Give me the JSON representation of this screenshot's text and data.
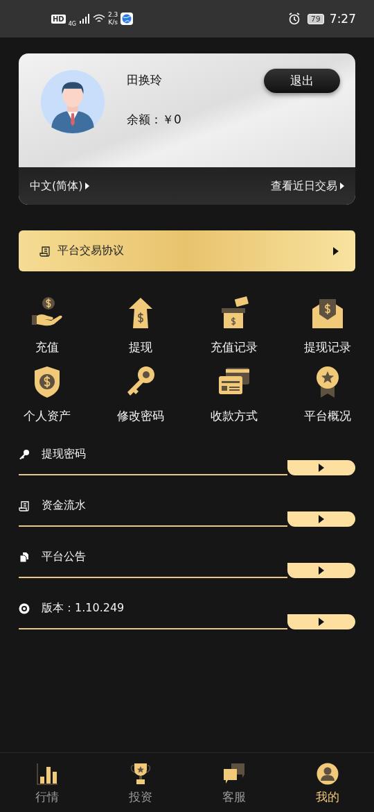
{
  "status_bar": {
    "hd": "HD",
    "network": "4G",
    "speed_value": "2.3",
    "speed_unit": "K/s",
    "battery": "79",
    "time": "7:27"
  },
  "profile": {
    "name": "田换玲",
    "balance": "余额：￥0",
    "logout": "退出",
    "language": "中文(简体)",
    "recent": "查看近日交易"
  },
  "agreement": {
    "label": "平台交易协议"
  },
  "shortcuts": [
    {
      "kind": "deposit",
      "label": "充值"
    },
    {
      "kind": "withdraw",
      "label": "提现"
    },
    {
      "kind": "deposit_log",
      "label": "充值记录"
    },
    {
      "kind": "withdraw_log",
      "label": "提现记录"
    },
    {
      "kind": "assets",
      "label": "个人资产"
    },
    {
      "kind": "password",
      "label": "修改密码"
    },
    {
      "kind": "payment",
      "label": "收款方式"
    },
    {
      "kind": "overview",
      "label": "平台概况"
    }
  ],
  "menu": [
    {
      "kind": "key",
      "label": "提现密码"
    },
    {
      "kind": "receipt",
      "label": "资金流水"
    },
    {
      "kind": "notice",
      "label": "平台公告"
    },
    {
      "kind": "disc",
      "label": "版本：1.10.249"
    }
  ],
  "tabs": [
    {
      "kind": "chart",
      "label": "行情",
      "selected": false
    },
    {
      "kind": "trophy",
      "label": "投资",
      "selected": false
    },
    {
      "kind": "chat",
      "label": "客服",
      "selected": false
    },
    {
      "kind": "user",
      "label": "我的",
      "selected": true
    }
  ]
}
